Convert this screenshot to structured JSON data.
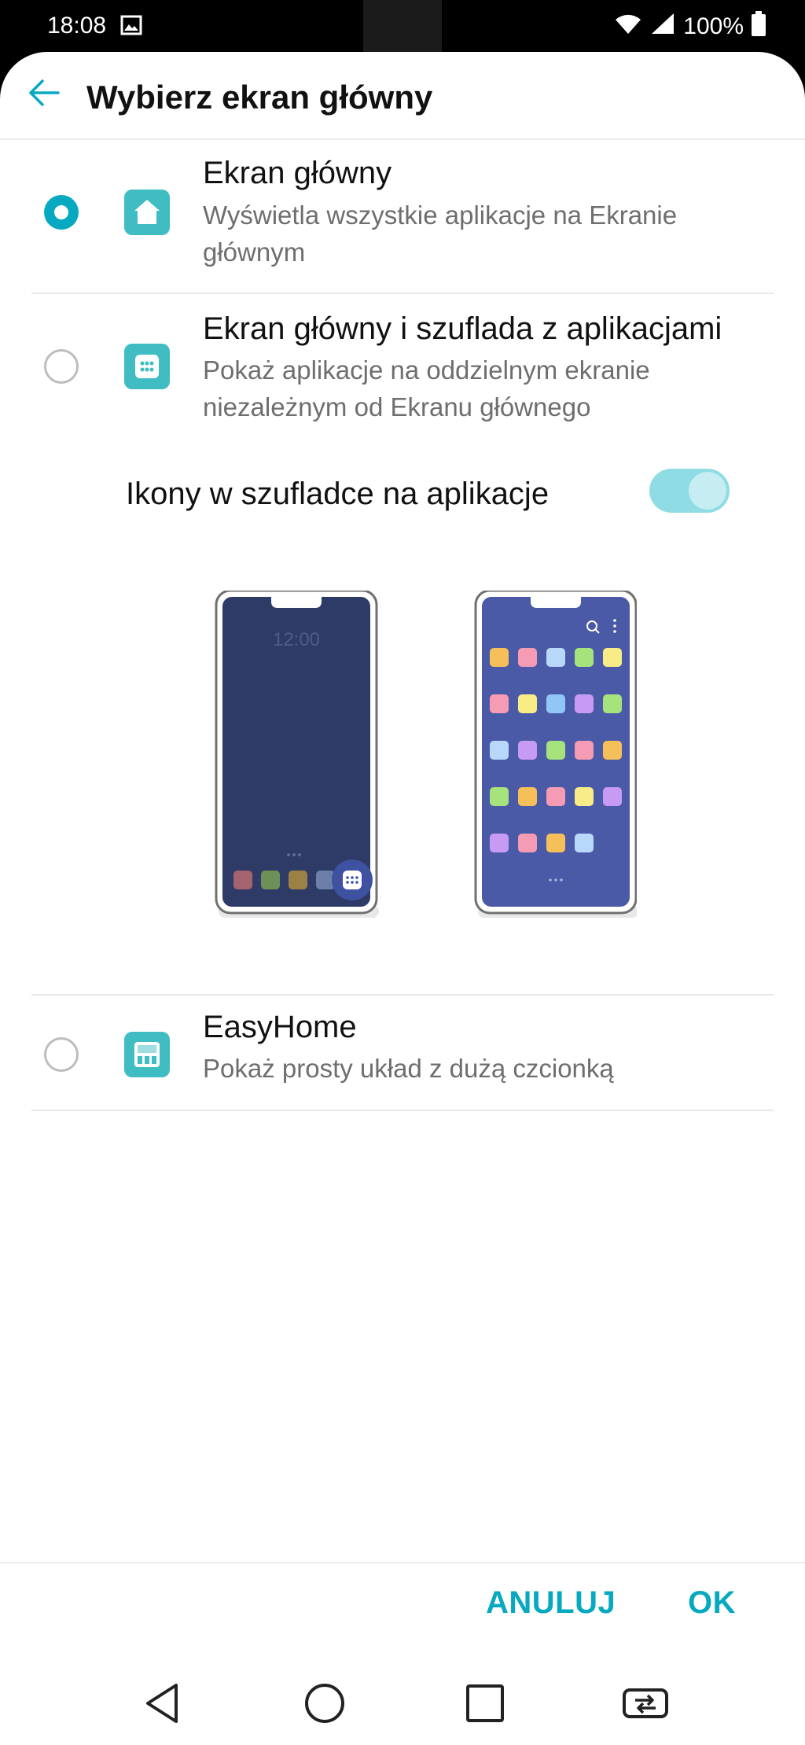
{
  "status_bar": {
    "time": "18:08",
    "battery": "100%"
  },
  "app_bar": {
    "title": "Wybierz ekran główny"
  },
  "options": [
    {
      "title": "Ekran główny",
      "description": "Wyświetla wszystkie aplikacje na Ekranie głównym",
      "selected": true,
      "icon": "home-icon"
    },
    {
      "title": "Ekran główny i szuflada z aplikacjami",
      "description": "Pokaż aplikacje na oddzielnym ekranie niezależnym od Ekranu głównego",
      "selected": false,
      "icon": "app-drawer-icon"
    },
    {
      "title": "EasyHome",
      "description": "Pokaż prosty układ z dużą czcionką",
      "selected": false,
      "icon": "easyhome-icon"
    }
  ],
  "drawer_toggle": {
    "label": "Ikony w szufladce na aplikacje",
    "on": true
  },
  "illustration": {
    "lock_time": "12:00"
  },
  "actions": {
    "cancel": "ANULUJ",
    "ok": "OK"
  },
  "colors": {
    "accent": "#07a9c0",
    "icon_teal": "#3fbdc3",
    "toggle_track": "#8fdce4"
  }
}
